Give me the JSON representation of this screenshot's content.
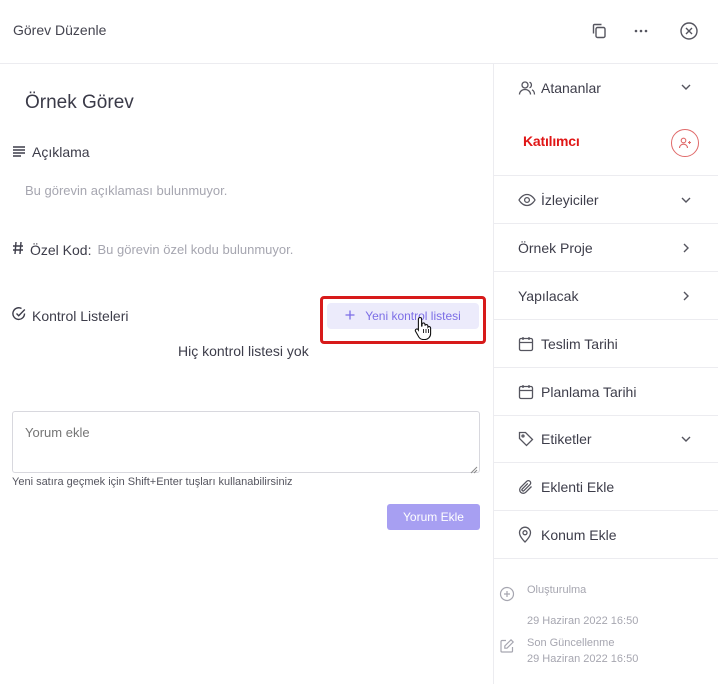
{
  "header": {
    "title": "Görev Düzenle",
    "actions": [
      "copy-icon",
      "more-icon",
      "close-icon"
    ]
  },
  "task": {
    "title": "Örnek Görev",
    "description_label": "Açıklama",
    "description_empty": "Bu görevin açıklaması bulunmuyor.",
    "code_label": "Özel Kod:",
    "code_empty": "Bu görevin özel kodu bulunmuyor.",
    "checklist_label": "Kontrol Listeleri",
    "add_checklist": "Yeni kontrol listesi",
    "no_checklist": "Hiç kontrol listesi yok"
  },
  "comment": {
    "placeholder": "Yorum ekle",
    "hint": "Yeni satıra geçmek için Shift+Enter tuşları kullanabilirsiniz",
    "submit": "Yorum Ekle"
  },
  "sidebar": {
    "assignees": "Atananlar",
    "participant": "Katılımcı",
    "watchers": "İzleyiciler",
    "project": "Örnek Proje",
    "status": "Yapılacak",
    "due_date": "Teslim Tarihi",
    "plan_date": "Planlama Tarihi",
    "tags": "Etiketler",
    "attachment": "Eklenti Ekle",
    "location": "Konum Ekle"
  },
  "meta": {
    "created_label": "Oluşturulma",
    "created_date": "29 Haziran 2022 16:50",
    "updated_label": "Son Güncellenme",
    "updated_date": "29 Haziran 2022 16:50"
  },
  "colors": {
    "accent": "#7c6ee6",
    "accent_bg": "#ecebfb",
    "button": "#a79ff2",
    "highlight": "#d71a1a"
  }
}
